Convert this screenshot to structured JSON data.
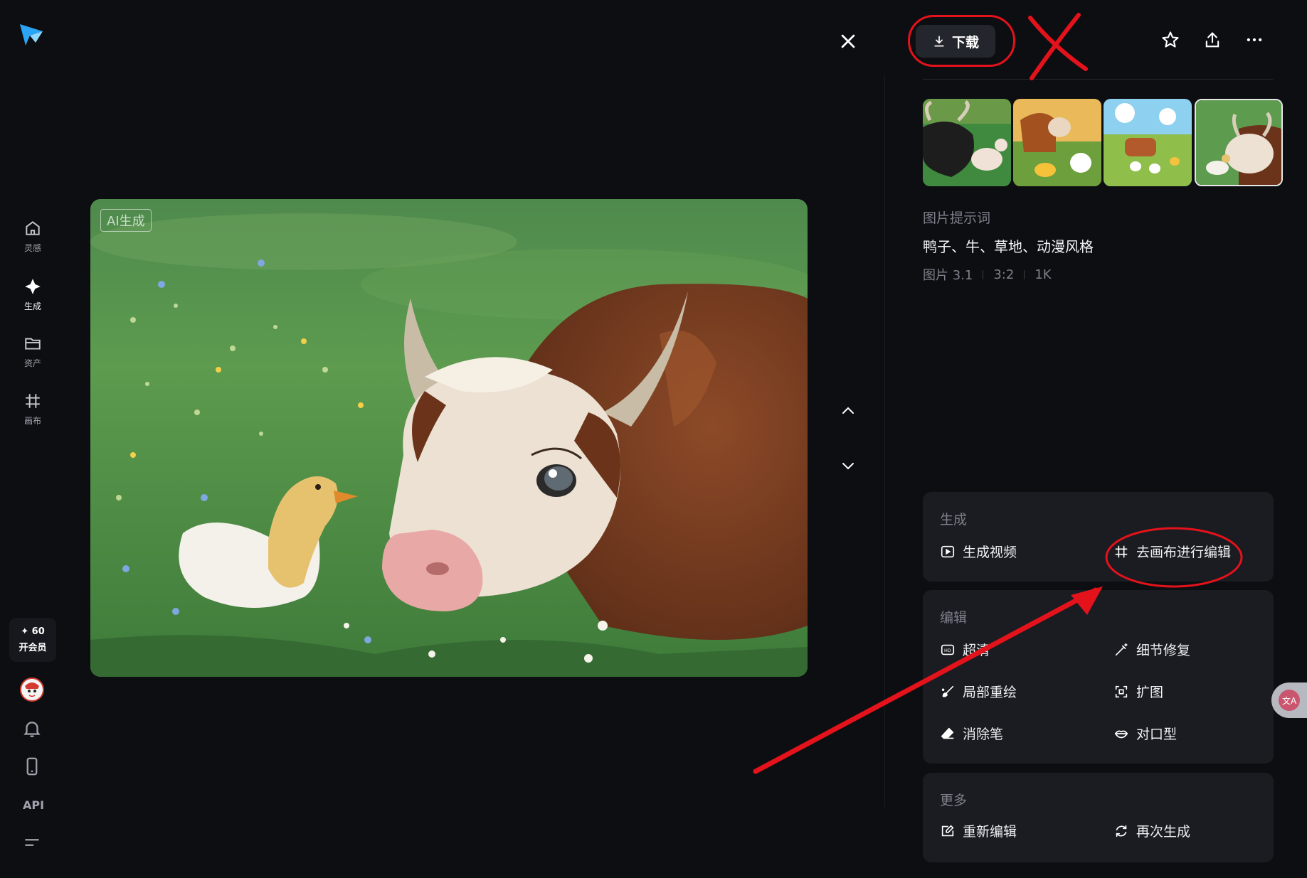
{
  "sidebar": {
    "items": [
      {
        "label": "灵感",
        "icon": "home-icon"
      },
      {
        "label": "生成",
        "icon": "sparkle-icon"
      },
      {
        "label": "资产",
        "icon": "folder-icon"
      },
      {
        "label": "画布",
        "icon": "canvas-icon"
      }
    ],
    "member": {
      "points": "✦ 60",
      "label": "开会员"
    },
    "bottom": {
      "notification_icon": "bell-icon",
      "device_icon": "phone-icon",
      "api_label": "API",
      "menu_icon": "menu-icon"
    }
  },
  "viewer": {
    "ai_badge": "AI生成",
    "image_description_icon": "duck-and-cow-image"
  },
  "toolbar": {
    "download_label": "下载",
    "icons": [
      "star-icon",
      "share-icon",
      "more-icon"
    ]
  },
  "details": {
    "prompt_heading": "图片提示词",
    "prompt_text": "鸭子、牛、草地、动漫风格",
    "meta": [
      "图片 3.1",
      "3:2",
      "1K"
    ]
  },
  "panels": {
    "generate": {
      "title": "生成",
      "actions": [
        {
          "label": "生成视频",
          "icon": "play-icon"
        },
        {
          "label": "去画布进行编辑",
          "icon": "canvas-icon"
        }
      ]
    },
    "edit": {
      "title": "编辑",
      "actions": [
        {
          "label": "超清",
          "icon": "hd-icon"
        },
        {
          "label": "细节修复",
          "icon": "wand-icon"
        },
        {
          "label": "局部重绘",
          "icon": "brush-icon"
        },
        {
          "label": "扩图",
          "icon": "expand-icon"
        },
        {
          "label": "消除笔",
          "icon": "eraser-icon"
        },
        {
          "label": "对口型",
          "icon": "lips-icon"
        }
      ]
    },
    "more": {
      "title": "更多",
      "actions": [
        {
          "label": "重新编辑",
          "icon": "edit-icon"
        },
        {
          "label": "再次生成",
          "icon": "regenerate-icon"
        }
      ]
    }
  },
  "colors": {
    "background": "#0d0e12",
    "card": "#1a1c21",
    "annotation": "#e3121b"
  }
}
